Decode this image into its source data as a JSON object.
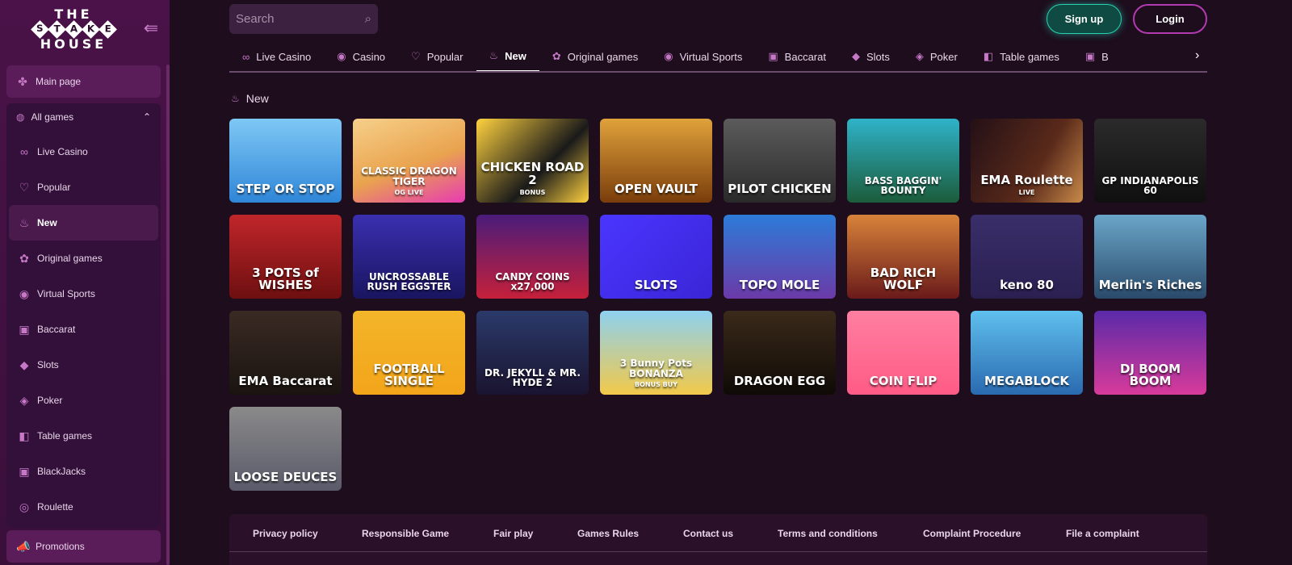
{
  "logo": {
    "top": "THE",
    "middle": [
      "S",
      "T",
      "A",
      "K",
      "E"
    ],
    "bottom": "HOUSE"
  },
  "sidebar": {
    "main_page": {
      "label": "Main page",
      "icon": "pinwheel-icon"
    },
    "all_games": {
      "label": "All games",
      "icon": "globe-icon"
    },
    "items": [
      {
        "label": "Live Casino",
        "icon": "link-icon"
      },
      {
        "label": "Popular",
        "icon": "heart-icon"
      },
      {
        "label": "New",
        "icon": "flame-icon",
        "active": true
      },
      {
        "label": "Original games",
        "icon": "flower-icon"
      },
      {
        "label": "Virtual Sports",
        "icon": "ball-icon"
      },
      {
        "label": "Baccarat",
        "icon": "cards-icon"
      },
      {
        "label": "Slots",
        "icon": "gem-icon"
      },
      {
        "label": "Poker",
        "icon": "chip-icon"
      },
      {
        "label": "Table games",
        "icon": "table-icon"
      },
      {
        "label": "BlackJacks",
        "icon": "cards-icon"
      },
      {
        "label": "Roulette",
        "icon": "roulette-icon"
      }
    ],
    "promotions": {
      "label": "Promotions",
      "icon": "megaphone-icon"
    }
  },
  "header": {
    "search_placeholder": "Search",
    "signup": "Sign up",
    "login": "Login"
  },
  "tabs": [
    {
      "label": "Live Casino",
      "icon": "link-icon"
    },
    {
      "label": "Casino",
      "icon": "ball-icon"
    },
    {
      "label": "Popular",
      "icon": "heart-icon"
    },
    {
      "label": "New",
      "icon": "flame-icon",
      "active": true
    },
    {
      "label": "Original games",
      "icon": "flower-icon"
    },
    {
      "label": "Virtual Sports",
      "icon": "ball-icon"
    },
    {
      "label": "Baccarat",
      "icon": "cards-icon"
    },
    {
      "label": "Slots",
      "icon": "gem-icon"
    },
    {
      "label": "Poker",
      "icon": "chip-icon"
    },
    {
      "label": "Table games",
      "icon": "table-icon"
    },
    {
      "label": "B",
      "icon": "cards-icon"
    }
  ],
  "section": {
    "title": "New"
  },
  "games": [
    {
      "name": "STEP OR STOP",
      "bg": "linear-gradient(180deg,#7ec8f5,#2f86d8)"
    },
    {
      "name": "CLASSIC DRAGON TIGER",
      "sub": "OG LIVE",
      "bg": "linear-gradient(160deg,#f6d08a,#e9a34e 55%,#e73bb2)"
    },
    {
      "name": "CHICKEN ROAD 2",
      "sub": "BONUS",
      "bg": "linear-gradient(135deg,#ffd23f,#1a1a1a 60%,#ffd23f)"
    },
    {
      "name": "OPEN VAULT",
      "bg": "linear-gradient(180deg,#e0a23a,#7a3d0b)"
    },
    {
      "name": "PILOT CHICKEN",
      "bg": "linear-gradient(180deg,#5b5b5b,#2a2a2a)"
    },
    {
      "name": "BASS BAGGIN' BOUNTY",
      "bg": "linear-gradient(180deg,#2fb3c9,#1b5c3b)"
    },
    {
      "name": "EMA Roulette",
      "sub": "LIVE",
      "bg": "linear-gradient(120deg,#241016,#5a2a1a 60%,#c98a4a)"
    },
    {
      "name": "GP INDIANAPOLIS 60",
      "bg": "linear-gradient(180deg,#2b2b2b,#0f0f0f)"
    },
    {
      "name": "3 POTS of WISHES",
      "bg": "linear-gradient(180deg,#c0262a,#6e0f10)"
    },
    {
      "name": "UNCROSSABLE RUSH EGGSTER",
      "bg": "linear-gradient(180deg,#3a2fb0,#1a1560)"
    },
    {
      "name": "CANDY COINS x27,000",
      "bg": "linear-gradient(180deg,#4a1c7a,#c5203a)"
    },
    {
      "name": "SLOTS",
      "bg": "linear-gradient(135deg,#4a35ff,#3a26d6)"
    },
    {
      "name": "TOPO MOLE",
      "bg": "linear-gradient(180deg,#2d7bd8,#6b3aa8)"
    },
    {
      "name": "BAD RICH WOLF",
      "bg": "linear-gradient(180deg,#d8833a,#6a1a1a)"
    },
    {
      "name": "keno 80",
      "bg": "linear-gradient(180deg,#3a2e6a,#2a2050)"
    },
    {
      "name": "Merlin's Riches",
      "bg": "linear-gradient(180deg,#6aa6c9,#2a4a6a)"
    },
    {
      "name": "EMA Baccarat",
      "bg": "linear-gradient(180deg,#3a2a24,#1a1410)"
    },
    {
      "name": "FOOTBALL SINGLE",
      "bg": "linear-gradient(180deg,#f3b52a,#f3a51a)"
    },
    {
      "name": "DR. JEKYLL & MR. HYDE 2",
      "bg": "linear-gradient(180deg,#2a3a6a,#1a1430)"
    },
    {
      "name": "3 Bunny Pots BONANZA",
      "sub": "BONUS BUY",
      "bg": "linear-gradient(180deg,#8ed1f0,#f2c94a)"
    },
    {
      "name": "DRAGON EGG",
      "bg": "linear-gradient(180deg,#3a2a1a,#0f0a06)"
    },
    {
      "name": "COIN FLIP",
      "bg": "linear-gradient(180deg,#ff7fa0,#ff5b86)"
    },
    {
      "name": "MEGABLOCK",
      "bg": "linear-gradient(180deg,#5fc0ee,#2a6ab0)"
    },
    {
      "name": "DJ BOOM BOOM",
      "bg": "linear-gradient(180deg,#5a2aa8,#d83a9a)"
    },
    {
      "name": "LOOSE DEUCES",
      "bg": "linear-gradient(180deg,#8a8a8a,#5a5a6a)"
    }
  ],
  "footer": {
    "links": [
      "Privacy policy",
      "Responsible Game",
      "Fair play",
      "Games Rules",
      "Contact us",
      "Terms and conditions",
      "Complaint Procedure",
      "File a complaint"
    ]
  },
  "colors": {
    "background": "#1d0d1d",
    "sidebar": "#4a1248",
    "accent": "#c678c7",
    "signup_glow": "#27d1b0",
    "login_border": "#b23ab0"
  }
}
